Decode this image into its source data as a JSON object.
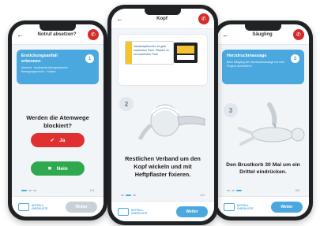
{
  "left_screen": {
    "title": "Notruf absetzen?",
    "card_heading": "Erstickungsanfall erkennen",
    "card_text": "Atemnot · keuchende Atemgeräusche · Bewegungsunruhe · Husten",
    "step": "1",
    "question": "Werden die Atemwege blockiert?",
    "yes_label": "Ja",
    "no_label": "Nein",
    "page": "1/4",
    "bottom_label": "NOTFALL-CHECKLISTE",
    "next_label": "Weiter"
  },
  "center_screen": {
    "title": "Kopf",
    "kit_text": "Verbandpäckchen im gelb markierten Fach, Pflaster im rot markierten Fach",
    "step": "2",
    "instruction": "Restlichen Verband um den Kopf wickeln und mit Heftpflaster fixieren.",
    "page": "2/4",
    "bottom_label": "NOTFALL-CHECKLISTE",
    "next_label": "Weiter"
  },
  "right_screen": {
    "title": "Säugling",
    "card_heading": "Herzdruckmassage",
    "card_text": "Beim Säugling die Herzdruckmassage mit zwei Fingern durchführen",
    "step": "3",
    "instruction": "Den Brustkorb 30 Mal um ein Drittel eindrücken.",
    "page": "3/4",
    "bottom_label": "NOTFALL-CHECKLISTE",
    "next_label": "Weiter"
  },
  "colors": {
    "accent": "#4aa8de",
    "danger": "#e03131",
    "success": "#2fa84f",
    "call": "#d62b2b",
    "kit_yellow": "#f4c430"
  }
}
